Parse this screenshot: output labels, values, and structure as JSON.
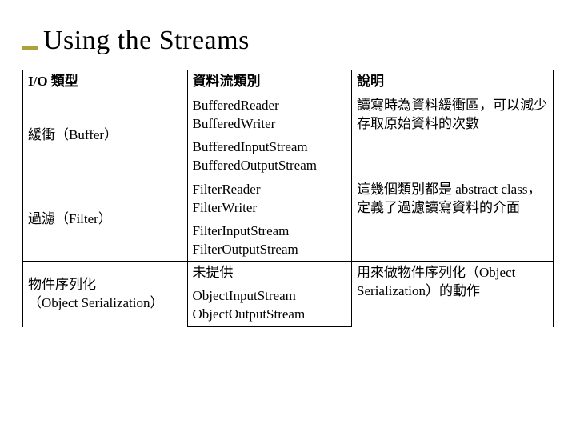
{
  "title": "Using the Streams",
  "headers": {
    "c1": "I/O 類型",
    "c2": "資料流類別",
    "c3": "說明"
  },
  "rows": {
    "buffer": {
      "label": "緩衝（Buffer）",
      "group1": "BufferedReader\nBufferedWriter",
      "group2": "BufferedInputStream\nBufferedOutputStream",
      "desc": "讀寫時為資料緩衝區，可以減少存取原始資料的次數"
    },
    "filter": {
      "label": "過濾（Filter）",
      "group1": "FilterReader\nFilterWriter",
      "group2": "FilterInputStream\nFilterOutputStream",
      "desc": "這幾個類別都是 abstract class，定義了過濾讀寫資料的介面"
    },
    "serial": {
      "label": "物件序列化\n（Object Serialization）",
      "group1": "未提供",
      "group2": "ObjectInputStream\nObjectOutputStream",
      "desc": "用來做物件序列化（Object Serialization）的動作"
    }
  }
}
